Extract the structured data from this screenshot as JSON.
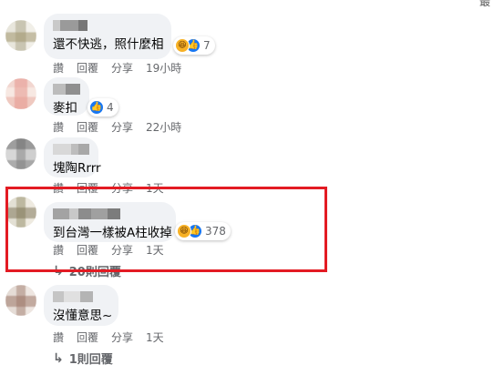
{
  "corner_text": "最",
  "comments": [
    {
      "text": "還不快逃，照什麼相",
      "reaction_count": "7",
      "reactions": [
        "haha",
        "like"
      ],
      "actions": {
        "read": "讚",
        "reply": "回覆",
        "share": "分享",
        "time": "19小時"
      }
    },
    {
      "text": "麥扣",
      "reaction_count": "4",
      "reactions": [
        "like"
      ],
      "actions": {
        "read": "讚",
        "reply": "回覆",
        "share": "分享",
        "time": "22小時"
      }
    },
    {
      "text": "塊陶Rrrr",
      "actions": {
        "read": "讚",
        "reply": "回覆",
        "share": "分享",
        "time": "1天"
      }
    },
    {
      "text": "到台灣一樣被A柱收掉",
      "reaction_count": "378",
      "reactions": [
        "haha",
        "like"
      ],
      "actions": {
        "read": "讚",
        "reply": "回覆",
        "share": "分享",
        "time": "1天"
      },
      "replies_label": "20則回覆"
    },
    {
      "text": "沒懂意思~",
      "actions": {
        "read": "讚",
        "reply": "回覆",
        "share": "分享",
        "time": "1天"
      },
      "replies_label": "1則回覆"
    }
  ],
  "colors": {
    "bubble_bg": "#f0f2f5",
    "meta_text": "#65676b",
    "highlight": "#e31b23",
    "like_blue": "#1877f2",
    "haha_yellow": "#f7b125"
  },
  "icons": {
    "haha": "haha-reaction-icon",
    "like": "like-reaction-icon",
    "reply_arrow": "reply-arrow-icon"
  }
}
